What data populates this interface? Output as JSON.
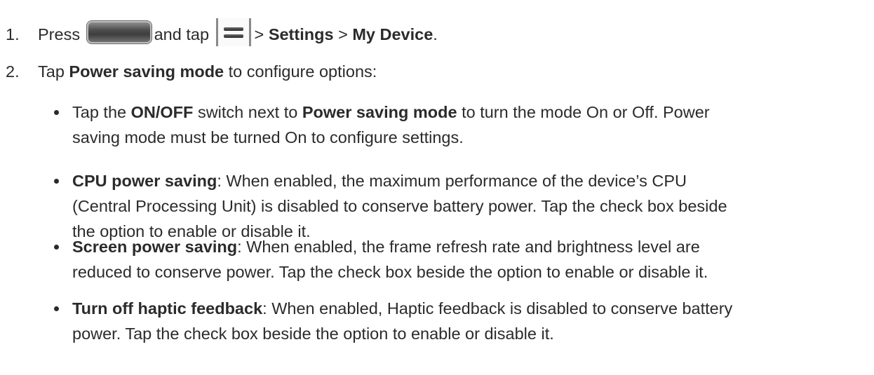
{
  "step1": {
    "number": "1.",
    "press": "Press",
    "home_button_icon": "home-button-icon",
    "and_tap": "and tap",
    "menu_icon": "menu-icon",
    "sep1": ">",
    "settings": "Settings",
    "sep2": ">",
    "my_device": "My Device",
    "end": "."
  },
  "step2": {
    "number": "2.",
    "tap": "Tap",
    "power_saving_mode": "Power saving mode",
    "rest": "to configure options:"
  },
  "bullets": [
    {
      "pre": "Tap the",
      "b1": "ON/OFF",
      "mid": "switch next to",
      "b2": "Power saving mode",
      "line1_rest": "to turn the mode On or Off. Power",
      "line2": "saving mode must be turned On to configure settings."
    },
    {
      "title": "CPU power saving",
      "line1_rest": ": When enabled, the maximum performance of the device’s CPU",
      "line2": "(Central Processing Unit) is disabled to conserve battery power. Tap the check box beside",
      "line3": "the option to enable or disable it."
    },
    {
      "title": "Screen power saving",
      "line1_rest": ": When enabled, the frame refresh rate and brightness level are",
      "line2": "reduced to conserve power. Tap the check box beside the option to enable or disable it."
    },
    {
      "title": "Turn off haptic feedback",
      "line1_rest": ": When enabled, Haptic feedback is disabled to conserve battery",
      "line2": "power. Tap the check box beside the option to enable or disable it."
    }
  ]
}
